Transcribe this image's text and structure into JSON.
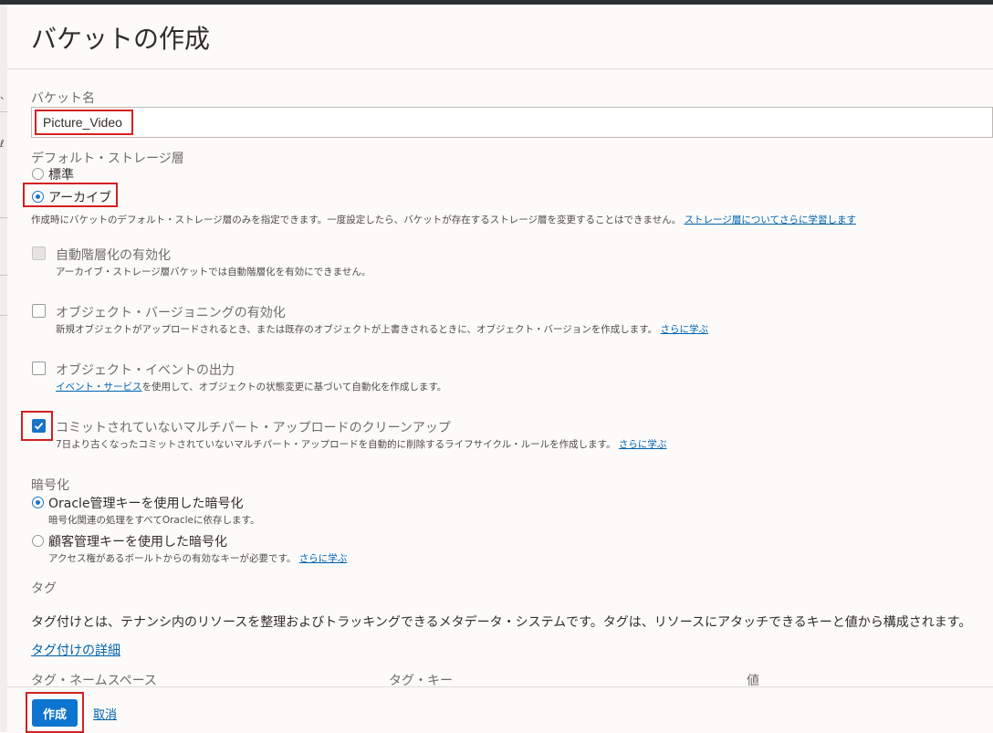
{
  "dialog": {
    "title": "バケットの作成"
  },
  "bucket_name": {
    "label": "バケット名",
    "value": "Picture_Video"
  },
  "storage_tier": {
    "label": "デフォルト・ストレージ層",
    "options": [
      {
        "label": "標準",
        "selected": false
      },
      {
        "label": "アーカイブ",
        "selected": true
      }
    ],
    "help_text": "作成時にバケットのデフォルト・ストレージ層のみを指定できます。一度設定したら、バケットが存在するストレージ層を変更することはできません。",
    "help_link": "ストレージ層についてさらに学習します"
  },
  "options": {
    "auto_tiering": {
      "label": "自動階層化の有効化",
      "help": "アーカイブ・ストレージ層バケットでは自動階層化を有効にできません。",
      "checked": false,
      "disabled": true
    },
    "versioning": {
      "label": "オブジェクト・バージョニングの有効化",
      "help": "新規オブジェクトがアップロードされるとき、または既存のオブジェクトが上書きされるときに、オブジェクト・バージョンを作成します。",
      "link": "さらに学ぶ",
      "checked": false
    },
    "events": {
      "label": "オブジェクト・イベントの出力",
      "help_link": "イベント・サービス",
      "help": "を使用して、オブジェクトの状態変更に基づいて自動化を作成します。",
      "checked": false
    },
    "cleanup": {
      "label": "コミットされていないマルチパート・アップロードのクリーンアップ",
      "help": "7日より古くなったコミットされていないマルチパート・アップロードを自動的に削除するライフサイクル・ルールを作成します。",
      "link": "さらに学ぶ",
      "checked": true
    }
  },
  "encryption": {
    "label": "暗号化",
    "options": [
      {
        "label": "Oracle管理キーを使用した暗号化",
        "help": "暗号化関連の処理をすべてOracleに依存します。",
        "selected": true
      },
      {
        "label": "顧客管理キーを使用した暗号化",
        "help": "アクセス権があるボールトからの有効なキーが必要です。",
        "link": "さらに学ぶ",
        "selected": false
      }
    ]
  },
  "tags": {
    "label": "タグ",
    "description": "タグ付けとは、テナンシ内のリソースを整理およびトラッキングできるメタデータ・システムです。タグは、リソースにアタッチできるキーと値から構成されます。",
    "details_link": "タグ付けの詳細",
    "columns": [
      "タグ・ネームスペース",
      "タグ・キー",
      "値"
    ]
  },
  "footer": {
    "create_label": "作成",
    "cancel_label": "取消"
  },
  "colors": {
    "accent": "#0d74cf",
    "highlight": "#d42020"
  }
}
